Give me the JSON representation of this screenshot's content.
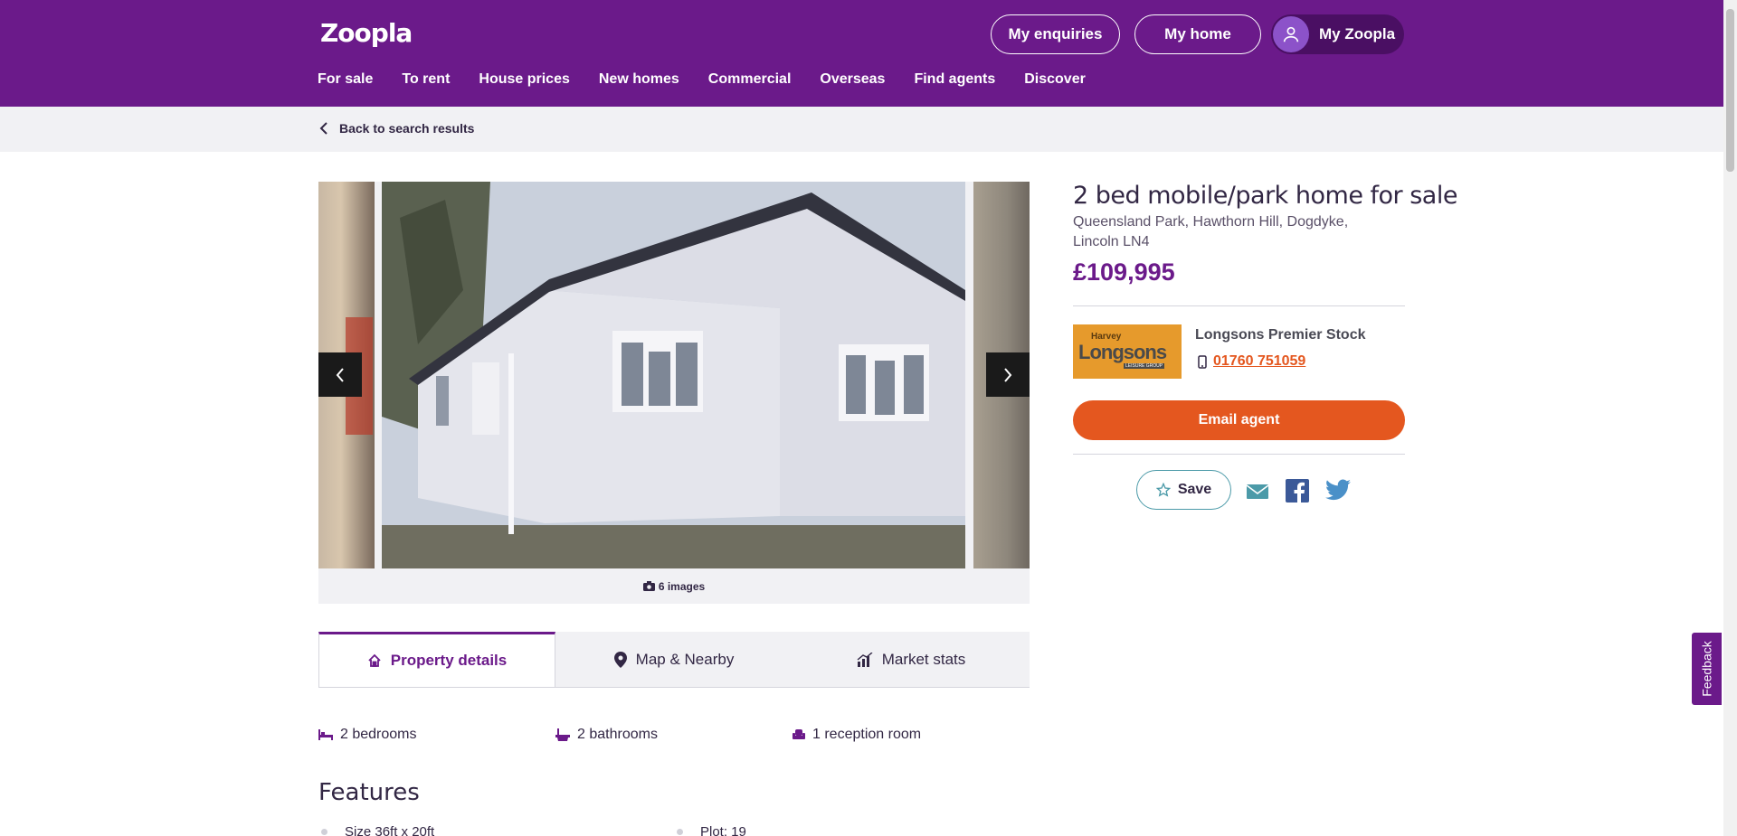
{
  "header": {
    "logo": "Zoopla",
    "enquiries_label": "My enquiries",
    "home_label": "My home",
    "my_zoopla_label": "My Zoopla",
    "nav": [
      "For sale",
      "To rent",
      "House prices",
      "New homes",
      "Commercial",
      "Overseas",
      "Find agents",
      "Discover"
    ]
  },
  "breadcrumb": {
    "back_label": "Back to search results"
  },
  "gallery": {
    "image_count": "6 images"
  },
  "tabs": [
    {
      "label": "Property details",
      "icon": "house-icon"
    },
    {
      "label": "Map & Nearby",
      "icon": "location-pin-icon"
    },
    {
      "label": "Market stats",
      "icon": "bar-chart-icon"
    }
  ],
  "facts": {
    "bedrooms": "2 bedrooms",
    "bathrooms": "2 bathrooms",
    "reception": "1 reception room"
  },
  "features": {
    "heading": "Features",
    "items": [
      "Size 36ft x 20ft",
      "Plot: 19"
    ]
  },
  "listing": {
    "title": "2 bed mobile/park home for sale",
    "address": "Queensland Park, Hawthorn Hill, Dogdyke, Lincoln LN4",
    "price": "£109,995"
  },
  "agent": {
    "logo_top": "Harvey",
    "logo_main": "Longsons",
    "logo_sub": "LEISURE GROUP",
    "name": "Longsons Premier Stock",
    "phone": "01760 751059",
    "email_label": "Email agent"
  },
  "actions": {
    "save_label": "Save"
  },
  "feedback_label": "Feedback",
  "colors": {
    "brand": "#6b1a8a",
    "accent": "#e4571f"
  }
}
